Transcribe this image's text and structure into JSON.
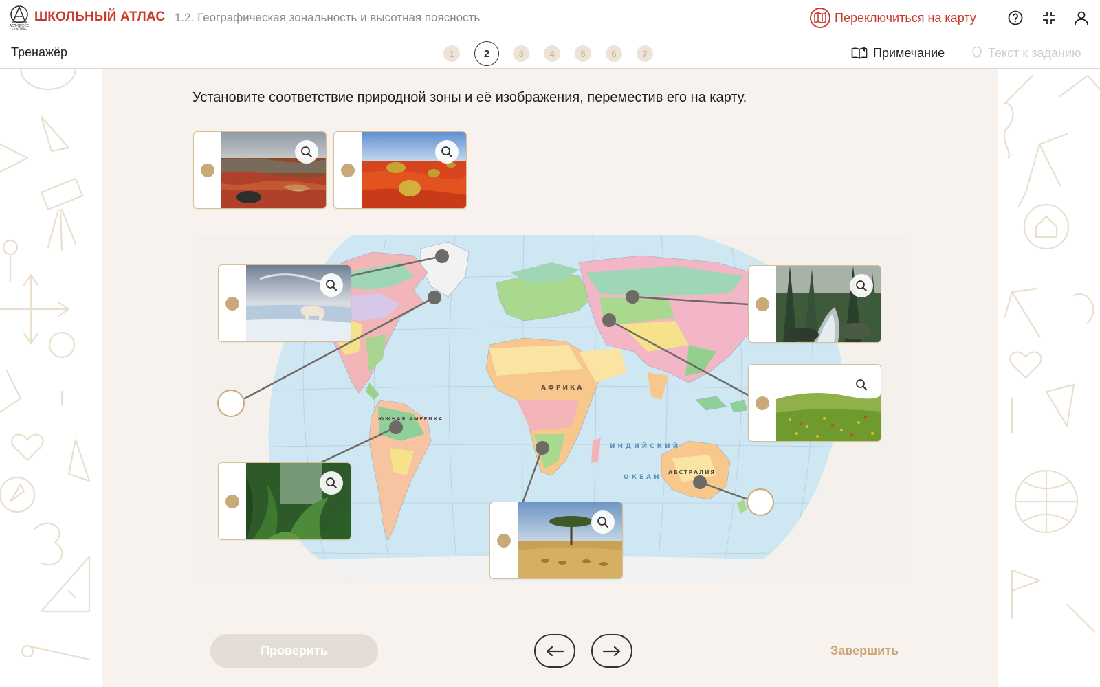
{
  "header": {
    "app_name": "ШКОЛЬНЫЙ АТЛАС",
    "logo_caption_1": "АСТ-ПРЕСС",
    "logo_caption_2": "«ШКОЛА»",
    "lesson_title": "1.2. Географическая зональность и высотная поясность",
    "switch_to_map": "Переключиться на карту",
    "icons": [
      "map-icon",
      "help-icon",
      "collapse-icon",
      "user-icon"
    ]
  },
  "subbar": {
    "title": "Тренажёр",
    "steps": [
      "1",
      "2",
      "3",
      "4",
      "5",
      "6",
      "7"
    ],
    "active_step": "2",
    "note_label": "Примечание",
    "task_text_label": "Текст к заданию"
  },
  "task": {
    "instruction": "Установите соответствие природной зоны и её изображения, переместив его на карту."
  },
  "cards": [
    {
      "name": "tundra-photo-card",
      "icon": "zoom-icon"
    },
    {
      "name": "desert-photo-card",
      "icon": "zoom-icon"
    },
    {
      "name": "arctic-desert-photo-card",
      "icon": "zoom-icon"
    },
    {
      "name": "taiga-photo-card",
      "icon": "zoom-icon"
    },
    {
      "name": "steppe-photo-card",
      "icon": "zoom-icon"
    },
    {
      "name": "rainforest-photo-card",
      "icon": "zoom-icon"
    },
    {
      "name": "savanna-photo-card",
      "icon": "zoom-icon"
    }
  ],
  "map": {
    "continent_labels": [
      "АФРИКА",
      "АВСТРАЛИЯ",
      "ЮЖНАЯ АМЕРИКА"
    ],
    "ocean_labels": [
      "ИНДИЙСКИЙ",
      "ОКЕАН"
    ]
  },
  "footer": {
    "check_label": "Проверить",
    "prev_icon": "arrow-left-icon",
    "next_icon": "arrow-right-icon",
    "finish_label": "Завершить"
  },
  "colors": {
    "brand_red": "#c9392b",
    "accent_tan": "#c8a97a",
    "panel_bg": "#f7f2ed",
    "ocean": "#cfe6f3",
    "disabled_button": "#e4ddd5"
  }
}
